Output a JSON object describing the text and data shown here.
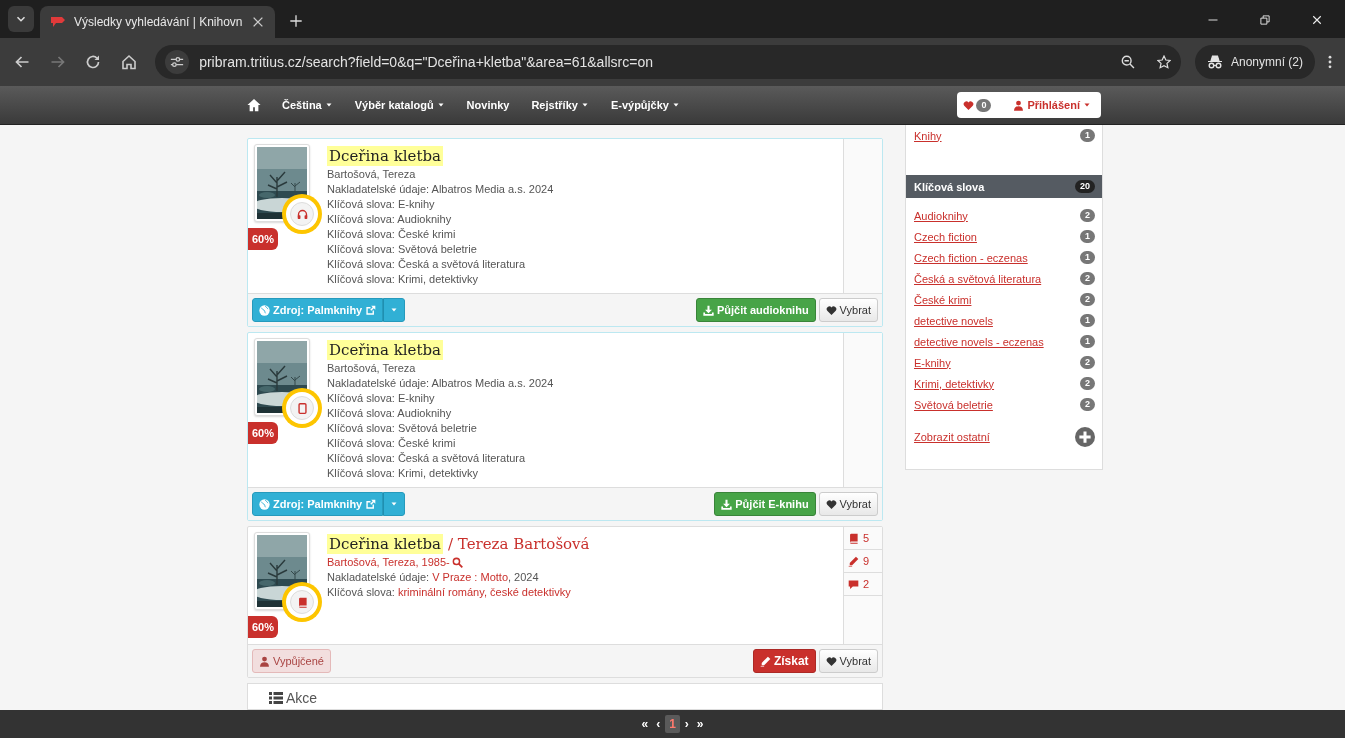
{
  "browser": {
    "tab_title": "Výsledky vyhledávání | Knihovn",
    "url": "pribram.tritius.cz/search?field=0&q=\"Dceřina+kletba\"&area=61&allsrc=on",
    "profile": "Anonymní (2)"
  },
  "navbar": {
    "items": [
      {
        "label": "Čeština",
        "dropdown": true
      },
      {
        "label": "Výběr katalogů",
        "dropdown": true
      },
      {
        "label": "Novinky",
        "dropdown": false
      },
      {
        "label": "Rejstříky",
        "dropdown": true
      },
      {
        "label": "E-výpůjčky",
        "dropdown": true
      }
    ],
    "favorites_count": "0",
    "login": "Přihlášení"
  },
  "results": [
    {
      "title": "Dceřina kletba",
      "kind": "audiobook",
      "match": "60%",
      "author": {
        "text": "Bartošová, Tereza",
        "link": false
      },
      "details": [
        {
          "label": "Nakladatelské údaje:",
          "parts": [
            {
              "text": "Albatros Media a.s. 2024",
              "link": false
            }
          ]
        },
        {
          "label": "Klíčová slova:",
          "parts": [
            {
              "text": "E-knihy",
              "link": false
            }
          ]
        },
        {
          "label": "Klíčová slova:",
          "parts": [
            {
              "text": "Audioknihy",
              "link": false
            }
          ]
        },
        {
          "label": "Klíčová slova:",
          "parts": [
            {
              "text": "České krimi",
              "link": false
            }
          ]
        },
        {
          "label": "Klíčová slova:",
          "parts": [
            {
              "text": "Světová beletrie",
              "link": false
            }
          ]
        },
        {
          "label": "Klíčová slova:",
          "parts": [
            {
              "text": "Česká a světová literatura",
              "link": false
            }
          ]
        },
        {
          "label": "Klíčová slova:",
          "parts": [
            {
              "text": "Krimi, detektivky",
              "link": false
            }
          ]
        }
      ],
      "footer_left": {
        "kind": "source",
        "label": "Zdroj: Palmknihy"
      },
      "footer_right": [
        {
          "kind": "borrow",
          "label": "Půjčit audioknihu"
        },
        {
          "kind": "select",
          "label": "Vybrat"
        }
      ]
    },
    {
      "title": "Dceřina kletba",
      "kind": "ebook",
      "match": "60%",
      "author": {
        "text": "Bartošová, Tereza",
        "link": false
      },
      "details": [
        {
          "label": "Nakladatelské údaje:",
          "parts": [
            {
              "text": "Albatros Media a.s. 2024",
              "link": false
            }
          ]
        },
        {
          "label": "Klíčová slova:",
          "parts": [
            {
              "text": "E-knihy",
              "link": false
            }
          ]
        },
        {
          "label": "Klíčová slova:",
          "parts": [
            {
              "text": "Audioknihy",
              "link": false
            }
          ]
        },
        {
          "label": "Klíčová slova:",
          "parts": [
            {
              "text": "Světová beletrie",
              "link": false
            }
          ]
        },
        {
          "label": "Klíčová slova:",
          "parts": [
            {
              "text": "České krimi",
              "link": false
            }
          ]
        },
        {
          "label": "Klíčová slova:",
          "parts": [
            {
              "text": "Česká a světová literatura",
              "link": false
            }
          ]
        },
        {
          "label": "Klíčová slova:",
          "parts": [
            {
              "text": "Krimi, detektivky",
              "link": false
            }
          ]
        }
      ],
      "footer_left": {
        "kind": "source",
        "label": "Zdroj: Palmknihy"
      },
      "footer_right": [
        {
          "kind": "borrow",
          "label": "Půjčit E-knihu"
        },
        {
          "kind": "select",
          "label": "Vybrat"
        }
      ]
    },
    {
      "title": "Dceřina kletba",
      "title_suffix": "/ Tereza Bartošová",
      "kind": "book",
      "match": "60%",
      "author": {
        "text": "Bartošová, Tereza, 1985-",
        "link": true
      },
      "details": [
        {
          "label": "Nakladatelské údaje:",
          "parts": [
            {
              "text": "V Praze : Motto",
              "link": true
            },
            {
              "text": ", 2024",
              "link": false
            }
          ]
        },
        {
          "label": "Klíčová slova:",
          "parts": [
            {
              "text": "kriminální romány, české detektivky",
              "link": true
            }
          ]
        }
      ],
      "stats": [
        {
          "kind": "copies",
          "count": "5"
        },
        {
          "kind": "reviews",
          "count": "9"
        },
        {
          "kind": "comments",
          "count": "2"
        }
      ],
      "footer_left": {
        "kind": "borrowed",
        "label": "Vypůjčené"
      },
      "footer_right": [
        {
          "kind": "acquire",
          "label": "Získat"
        },
        {
          "kind": "select",
          "label": "Vybrat"
        }
      ]
    }
  ],
  "actions": {
    "title": "Akce"
  },
  "sidebar": {
    "prev_item": {
      "label": "Knihy",
      "count": "1"
    },
    "facet": {
      "title": "Klíčová slova",
      "count": "20",
      "items": [
        {
          "label": "Audioknihy",
          "count": "2"
        },
        {
          "label": "Czech fiction",
          "count": "1"
        },
        {
          "label": "Czech fiction - eczenas",
          "count": "1"
        },
        {
          "label": "Česká a světová literatura",
          "count": "2"
        },
        {
          "label": "České krimi",
          "count": "2"
        },
        {
          "label": "detective novels",
          "count": "1"
        },
        {
          "label": "detective novels - eczenas",
          "count": "1"
        },
        {
          "label": "E-knihy",
          "count": "2"
        },
        {
          "label": "Krimi, detektivky",
          "count": "2"
        },
        {
          "label": "Světová beletrie",
          "count": "2"
        }
      ],
      "more": "Zobrazit ostatní"
    }
  },
  "pagination": [
    {
      "label": "«",
      "selected": false
    },
    {
      "label": "‹",
      "selected": false
    },
    {
      "label": "1",
      "selected": true
    },
    {
      "label": "›",
      "selected": false
    },
    {
      "label": "»",
      "selected": false
    }
  ]
}
